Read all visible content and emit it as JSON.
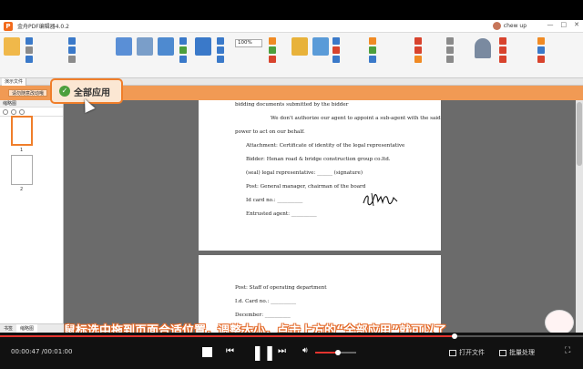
{
  "app": {
    "title": "金舟PDF编辑器4.0.2",
    "user_name": "chew up",
    "window_controls": [
      "—",
      "□",
      "✕"
    ]
  },
  "ribbon": {
    "zoom_value": "100%",
    "icons": [
      "file-icon",
      "open-icon",
      "print-icon",
      "hand-tool-icon",
      "select-icon",
      "zoom-icon",
      "text-icon",
      "image-icon",
      "link-icon",
      "stamp-icon",
      "pen-icon",
      "shape-icon"
    ]
  },
  "tabstrip": {
    "tab_label": "演示文件"
  },
  "orange_bar": {
    "label": "请勿随意改动哦"
  },
  "callout": {
    "text": "全部应用"
  },
  "thumbnails": {
    "panel_title": "缩略图",
    "pages": [
      "1",
      "2"
    ],
    "bottom_tabs": [
      "书签",
      "缩略图"
    ]
  },
  "document": {
    "page1_lines": [
      "bidding documents submitted by the bidder",
      "We don't authorize our agent to appoint a sub-agent with the said",
      "power to act on our behalf.",
      "Attachment: Certificate of identity of the legal representative",
      "Bidder: Henan road & bridge construction group co.ltd.",
      "(seal) legal representative: ______ (signature)",
      "Post: General manager, chairman of the board",
      "Id card no.: __________",
      "Entrusted agent: __________"
    ],
    "page2_lines": [
      "Post: Staff of operating department",
      "I.d. Card no.: __________",
      "December: __________"
    ]
  },
  "subtitle": {
    "text": "鼠标选中拖到页面合适位置，调整大小，点击上方的“全部应用”就可以了"
  },
  "player": {
    "time": "00:00:47 /00:01:00",
    "progress": 0.78,
    "volume": 0.55,
    "open_file_label": "打开文件",
    "batch_label": "批量处理",
    "colors": {
      "accent": "#e3342f",
      "orange": "#f07e2a"
    }
  }
}
